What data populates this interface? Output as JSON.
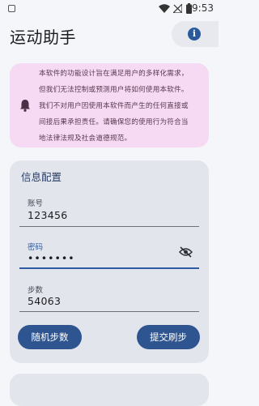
{
  "status_bar": {
    "time": "9:53"
  },
  "header": {
    "title": "运动助手",
    "info_icon": "info-icon"
  },
  "disclaimer": {
    "icon": "bell-icon",
    "lines": [
      "本软件的功能设计旨在满足用户的多样化需求，",
      "但我们无法控制或预测用户将如何使用本软件。",
      "我们不对用户因使用本软件而产生的任何直接或",
      "间接后果承担责任。请确保您的使用行为符合当",
      "地法律法规及社会道德规范。"
    ]
  },
  "config": {
    "title": "信息配置",
    "account": {
      "label": "账号",
      "value": "123456"
    },
    "password": {
      "label": "密码",
      "value": "•••••••",
      "toggle_icon": "eye-off-icon"
    },
    "steps": {
      "label": "步数",
      "value": "54063"
    },
    "random_button": "随机步数",
    "submit_button": "提交刷步"
  },
  "colors": {
    "accent": "#2f5591",
    "disclaimer_bg": "#f6d9f2",
    "card_bg": "#e3e5ec"
  }
}
